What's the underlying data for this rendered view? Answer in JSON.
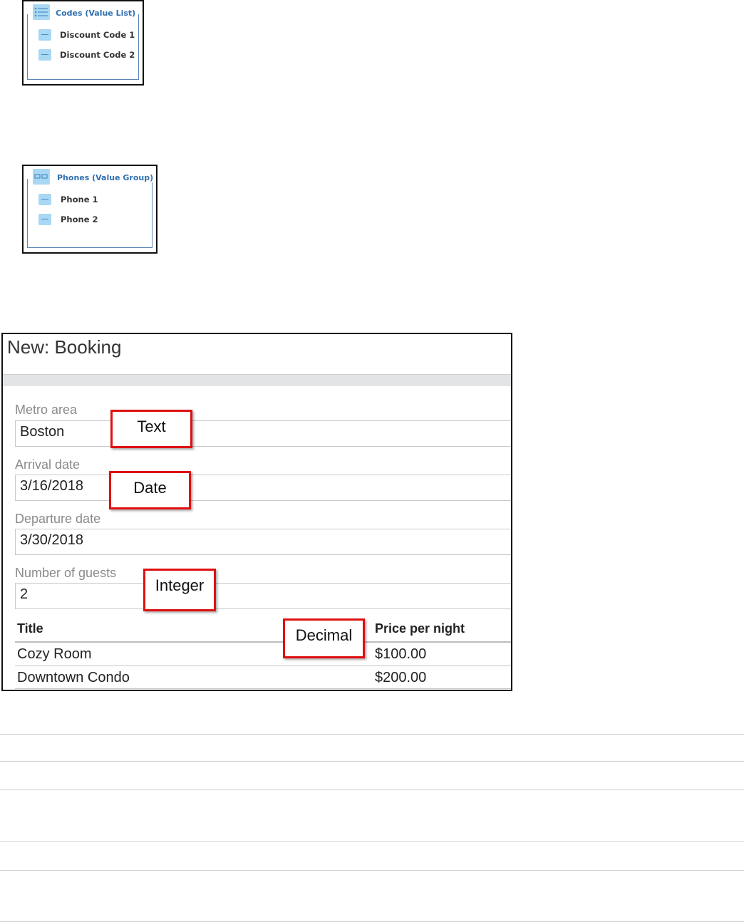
{
  "value_list": {
    "title": "Codes (Value List)",
    "items": [
      "Discount Code 1",
      "Discount Code 2"
    ]
  },
  "value_group": {
    "title": "Phones (Value Group)",
    "items": [
      "Phone 1",
      "Phone 2"
    ]
  },
  "form": {
    "title": "New:  Booking",
    "fields": [
      {
        "label": "Metro area",
        "value": "Boston"
      },
      {
        "label": "Arrival date",
        "value": "3/16/2018"
      },
      {
        "label": "Departure date",
        "value": "3/30/2018"
      },
      {
        "label": "Number of guests",
        "value": "2"
      }
    ],
    "table": {
      "headers": [
        "Title",
        "Price per night"
      ],
      "rows": [
        [
          "Cozy Room",
          "$100.00"
        ],
        [
          "Downtown Condo",
          "$200.00"
        ]
      ]
    }
  },
  "annotations": {
    "text": "Text",
    "date": "Date",
    "integer": "Integer",
    "decimal": "Decimal"
  },
  "colors": {
    "annotation_border": "#e01010",
    "diagram_blue": "#2f6fb0",
    "diagram_icon": "#a8d8f4"
  }
}
